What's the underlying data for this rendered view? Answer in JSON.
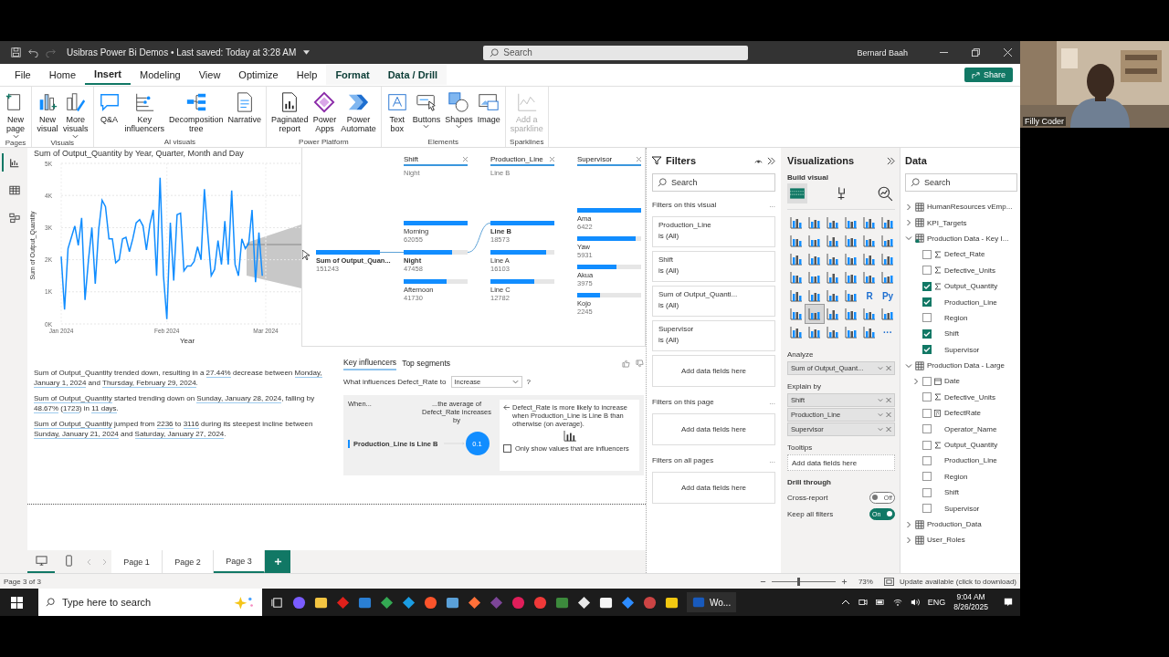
{
  "title_bar": {
    "title": "Usibras Power Bi Demos • Last saved: Today at 3:28 AM",
    "search": {
      "placeholder": "Search"
    },
    "user": "Bernard Baah"
  },
  "menu": [
    {
      "label": "File",
      "selected": false,
      "contextual": false
    },
    {
      "label": "Home",
      "selected": false,
      "contextual": false
    },
    {
      "label": "Insert",
      "selected": true,
      "contextual": false
    },
    {
      "label": "Modeling",
      "selected": false,
      "contextual": false
    },
    {
      "label": "View",
      "selected": false,
      "contextual": false
    },
    {
      "label": "Optimize",
      "selected": false,
      "contextual": false
    },
    {
      "label": "Help",
      "selected": false,
      "contextual": false
    },
    {
      "label": "Format",
      "selected": false,
      "contextual": true
    },
    {
      "label": "Data / Drill",
      "selected": false,
      "contextual": true
    }
  ],
  "share": "Share",
  "ribbon": [
    {
      "group": "Pages",
      "buttons": [
        {
          "lines": [
            "New",
            "page"
          ],
          "dropdown": true,
          "disabled": false
        }
      ]
    },
    {
      "group": "Visuals",
      "buttons": [
        {
          "lines": [
            "New",
            "visual"
          ],
          "dropdown": false,
          "disabled": false
        },
        {
          "lines": [
            "More",
            "visuals"
          ],
          "dropdown": true,
          "disabled": false
        }
      ]
    },
    {
      "group": "AI visuals",
      "buttons": [
        {
          "lines": [
            "Q&A"
          ],
          "dropdown": false,
          "disabled": false
        },
        {
          "lines": [
            "Key",
            "influencers"
          ],
          "dropdown": false,
          "disabled": false
        },
        {
          "lines": [
            "Decomposition",
            "tree"
          ],
          "dropdown": false,
          "disabled": false
        },
        {
          "lines": [
            "Narrative"
          ],
          "dropdown": false,
          "disabled": false
        }
      ]
    },
    {
      "group": "Power Platform",
      "buttons": [
        {
          "lines": [
            "Paginated",
            "report"
          ],
          "dropdown": false,
          "disabled": false
        },
        {
          "lines": [
            "Power",
            "Apps"
          ],
          "dropdown": false,
          "disabled": false
        },
        {
          "lines": [
            "Power",
            "Automate"
          ],
          "dropdown": false,
          "disabled": false
        }
      ]
    },
    {
      "group": "Elements",
      "buttons": [
        {
          "lines": [
            "Text",
            "box"
          ],
          "dropdown": false,
          "disabled": false
        },
        {
          "lines": [
            "Buttons"
          ],
          "dropdown": true,
          "disabled": false
        },
        {
          "lines": [
            "Shapes"
          ],
          "dropdown": true,
          "disabled": false
        },
        {
          "lines": [
            "Image"
          ],
          "dropdown": false,
          "disabled": false
        }
      ]
    },
    {
      "group": "Sparklines",
      "buttons": [
        {
          "lines": [
            "Add a",
            "sparkline"
          ],
          "dropdown": false,
          "disabled": true
        }
      ]
    }
  ],
  "view_rail": [
    {
      "selected": true
    },
    {
      "selected": false
    },
    {
      "selected": false
    }
  ],
  "line_chart": {
    "chart_data": {
      "type": "line",
      "title": "Sum of Output_Quantity by Year, Quarter, Month and Day",
      "xlabel": "Year",
      "ylabel": "Sum of Output_Quantity",
      "categories": [
        "Jan 2024",
        null,
        null,
        null,
        null,
        null,
        null,
        null,
        null,
        null,
        null,
        null,
        null,
        null,
        null,
        null,
        null,
        null,
        null,
        null,
        null,
        null,
        null,
        null,
        null,
        null,
        null,
        null,
        null,
        null,
        null,
        "Feb 2024",
        null,
        null,
        null,
        null,
        null,
        null,
        null,
        null,
        null,
        null,
        null,
        null,
        null,
        null,
        null,
        null,
        null,
        null,
        null,
        null,
        null,
        null,
        null,
        null,
        null,
        null,
        null,
        null,
        "Mar 2024"
      ],
      "ylim": [
        0,
        5000
      ],
      "grid": true,
      "yticks": [
        {
          "value": 0,
          "label": "0K"
        },
        {
          "value": 1000,
          "label": "1K"
        },
        {
          "value": 2000,
          "label": "2K"
        },
        {
          "value": 3000,
          "label": "3K"
        },
        {
          "value": 4000,
          "label": "4K"
        },
        {
          "value": 5000,
          "label": "5K"
        }
      ],
      "series": [
        {
          "color": "#118dff",
          "values": [
            2100,
            450,
            2350,
            2700,
            3050,
            2450,
            3300,
            750,
            2000,
            3000,
            1250,
            2950,
            3850,
            3650,
            2650,
            2650,
            1900,
            2000,
            2650,
            2700,
            2250,
            2650,
            3150,
            3250,
            3050,
            2300,
            3100,
            3550,
            1500,
            4550,
            1500,
            150,
            3150,
            1350,
            3400,
            3450,
            1650,
            1800,
            1800,
            1950,
            2400,
            2000,
            4200,
            2800,
            1500,
            1700,
            2600,
            1850,
            3200,
            1850,
            4150,
            1850,
            1500,
            2650,
            2350,
            2500,
            3550,
            1300,
            2850,
            1500,
            null
          ]
        }
      ]
    }
  },
  "decomposition_tree": {
    "root": {
      "name": "Sum of Output_Quan...",
      "value": "151243"
    },
    "levels": [
      {
        "header": "Shift",
        "filter": "Night",
        "nodes": [
          {
            "name": "Morning",
            "value": "62055",
            "level": 1,
            "selected": false
          },
          {
            "name": "Night",
            "value": "47458",
            "level": 0.76,
            "selected": true
          },
          {
            "name": "Afternoon",
            "value": "41730",
            "level": 0.67,
            "selected": false
          }
        ]
      },
      {
        "header": "Production_Line",
        "filter": "Line B",
        "nodes": [
          {
            "name": "Line B",
            "value": "18573",
            "level": 1,
            "selected": true
          },
          {
            "name": "Line A",
            "value": "16103",
            "level": 0.87,
            "selected": false
          },
          {
            "name": "Line C",
            "value": "12782",
            "level": 0.69,
            "selected": false
          }
        ]
      },
      {
        "header": "Supervisor",
        "nodes": [
          {
            "name": "Ama",
            "value": "6422",
            "level": 1,
            "selected": false
          },
          {
            "name": "Yaw",
            "value": "5931",
            "level": 0.92,
            "selected": false
          },
          {
            "name": "Akua",
            "value": "3975",
            "level": 0.62,
            "selected": false
          },
          {
            "name": "Kojo",
            "value": "2245",
            "level": 0.35,
            "selected": false
          }
        ]
      }
    ]
  },
  "narrative": [
    [
      {
        "text": "Sum of Output_Quantity trended down, resulting in a ",
        "underlined": false
      },
      {
        "text": "27.44%",
        "underlined": true
      },
      {
        "text": " decrease between ",
        "underlined": false
      },
      {
        "text": "Monday, January 1, 2024",
        "underlined": true
      },
      {
        "text": " and ",
        "underlined": false
      },
      {
        "text": "Thursday, February 29, 2024",
        "underlined": true
      },
      {
        "text": ".",
        "underlined": false
      }
    ],
    [
      {
        "text": "Sum of Output_Quantity",
        "underlined": true
      },
      {
        "text": " started trending down on ",
        "underlined": false
      },
      {
        "text": "Sunday, January 28, 2024",
        "underlined": true
      },
      {
        "text": ", falling by ",
        "underlined": false
      },
      {
        "text": "48.67%",
        "underlined": true
      },
      {
        "text": " (",
        "underlined": false
      },
      {
        "text": "1723",
        "underlined": true
      },
      {
        "text": ") in ",
        "underlined": false
      },
      {
        "text": "11 days",
        "underlined": true
      },
      {
        "text": ".",
        "underlined": false
      }
    ],
    [
      {
        "text": "Sum of Output_Quantity",
        "underlined": true
      },
      {
        "text": " jumped from ",
        "underlined": false
      },
      {
        "text": "2236",
        "underlined": true
      },
      {
        "text": " to ",
        "underlined": false
      },
      {
        "text": "3116",
        "underlined": true
      },
      {
        "text": " during its steepest incline between ",
        "underlined": false
      },
      {
        "text": "Sunday, January 21, 2024",
        "underlined": true
      },
      {
        "text": " and ",
        "underlined": false
      },
      {
        "text": "Saturday, January 27, 2024",
        "underlined": true
      },
      {
        "text": ".",
        "underlined": false
      }
    ]
  ],
  "key_influencers": {
    "tabs": [
      {
        "label": "Key influencers",
        "selected": true
      },
      {
        "label": "Top segments",
        "selected": false
      }
    ],
    "question": "What influences Defect_Rate to",
    "target": "Increase",
    "help": "?",
    "when": "When...",
    "effect": "...the average of Defect_Rate increases by",
    "factor": "Production_Line is Line B",
    "bubble": "0.1",
    "explanation": "Defect_Rate is more likely to increase when Production_Line is Line B than otherwise (on average).",
    "only_influencers": {
      "label": "Only show values that are influencers",
      "checked": false
    }
  },
  "page_tabs": [
    {
      "label": "Page 1",
      "selected": false
    },
    {
      "label": "Page 2",
      "selected": false
    },
    {
      "label": "Page 3",
      "selected": true
    }
  ],
  "layout_views": [
    {
      "selected": true
    },
    {
      "selected": false
    }
  ],
  "filters": {
    "title": "Filters",
    "search": {
      "placeholder": "Search"
    },
    "sections": [
      {
        "title": "Filters on this visual",
        "more": "...",
        "cards": [
          {
            "field": "Production_Line",
            "condition": "is (All)"
          },
          {
            "field": "Shift",
            "condition": "is (All)"
          },
          {
            "field": "Sum of Output_Quanti...",
            "condition": "is (All)"
          },
          {
            "field": "Supervisor",
            "condition": "is (All)"
          }
        ],
        "drop": "Add data fields here"
      },
      {
        "title": "Filters on this page",
        "more": "...",
        "drop": "Add data fields here"
      },
      {
        "title": "Filters on all pages",
        "more": "...",
        "drop": "Add data fields here"
      }
    ]
  },
  "visualizations": {
    "title": "Visualizations",
    "subtitle": "Build visual",
    "build_tabs": [
      {
        "selected": true
      },
      {
        "selected": false
      },
      {
        "selected": false
      }
    ],
    "types": [
      {
        "selected": false
      },
      {
        "selected": false
      },
      {
        "selected": false
      },
      {
        "selected": false
      },
      {
        "selected": false
      },
      {
        "selected": false
      },
      {
        "selected": false
      },
      {
        "selected": false
      },
      {
        "selected": false
      },
      {
        "selected": false
      },
      {
        "selected": false
      },
      {
        "selected": false
      },
      {
        "selected": false
      },
      {
        "selected": false
      },
      {
        "selected": false
      },
      {
        "selected": false
      },
      {
        "selected": false
      },
      {
        "selected": false
      },
      {
        "selected": false
      },
      {
        "selected": false
      },
      {
        "selected": false
      },
      {
        "selected": false
      },
      {
        "selected": false
      },
      {
        "selected": false
      },
      {
        "selected": false
      },
      {
        "selected": false
      },
      {
        "selected": false
      },
      {
        "selected": false
      },
      {
        "label": "R",
        "selected": false
      },
      {
        "label": "Py",
        "selected": false
      },
      {
        "selected": false
      },
      {
        "selected": true
      },
      {
        "selected": false
      },
      {
        "selected": false
      },
      {
        "selected": false
      },
      {
        "selected": false
      },
      {
        "selected": false
      },
      {
        "selected": false
      },
      {
        "selected": false
      },
      {
        "selected": false
      },
      {
        "selected": false
      },
      {
        "label": "···",
        "selected": false
      }
    ],
    "wells": [
      {
        "title": "Analyze",
        "fields": [
          "Sum of Output_Quant..."
        ]
      },
      {
        "title": "Explain by",
        "fields": [
          "Shift",
          "Production_Line",
          "Supervisor"
        ]
      },
      {
        "title": "Tooltips",
        "drop": "Add data fields here"
      }
    ],
    "drill_title": "Drill through",
    "toggles": [
      {
        "label": "Cross-report",
        "on": false,
        "text": "Off"
      },
      {
        "label": "Keep all filters",
        "on": true,
        "text": "On"
      }
    ]
  },
  "data_pane": {
    "title": "Data",
    "search": {
      "placeholder": "Search"
    },
    "tables": [
      {
        "name": "HumanResources vEmp...",
        "expanded": false,
        "in_use": false
      },
      {
        "name": "KPI_Targets",
        "expanded": false,
        "in_use": false
      },
      {
        "name": "Production Data - Key I...",
        "expanded": true,
        "in_use": true,
        "children": [
          {
            "name": "Defect_Rate",
            "kind": "sum",
            "checked": false
          },
          {
            "name": "Defective_Units",
            "kind": "sum",
            "checked": false
          },
          {
            "name": "Output_Quantity",
            "kind": "sum",
            "checked": true
          },
          {
            "name": "Production_Line",
            "kind": "plain",
            "checked": true
          },
          {
            "name": "Region",
            "kind": "plain",
            "checked": false
          },
          {
            "name": "Shift",
            "kind": "plain",
            "checked": true
          },
          {
            "name": "Supervisor",
            "kind": "plain",
            "checked": true
          }
        ]
      },
      {
        "name": "Production Data - Large",
        "expanded": true,
        "in_use": false,
        "children": [
          {
            "name": "Date",
            "kind": "date",
            "checked": false,
            "expanded": false
          },
          {
            "name": "Defective_Units",
            "kind": "sum",
            "checked": false
          },
          {
            "name": "DefectRate",
            "kind": "measure",
            "checked": false
          },
          {
            "name": "Operator_Name",
            "kind": "plain",
            "checked": false
          },
          {
            "name": "Output_Quantity",
            "kind": "sum",
            "checked": false
          },
          {
            "name": "Production_Line",
            "kind": "plain",
            "checked": false
          },
          {
            "name": "Region",
            "kind": "plain",
            "checked": false
          },
          {
            "name": "Shift",
            "kind": "plain",
            "checked": false
          },
          {
            "name": "Supervisor",
            "kind": "plain",
            "checked": false
          }
        ]
      },
      {
        "name": "Production_Data",
        "expanded": false,
        "in_use": false
      },
      {
        "name": "User_Roles",
        "expanded": false,
        "in_use": false
      }
    ]
  },
  "status_bar": {
    "page": "Page 3 of 3",
    "zoom": {
      "level": 0.4,
      "reading": "73%"
    },
    "update": "Update available (click to download)"
  },
  "webcam": {
    "kind": "picture",
    "caption": "Filly Coder"
  },
  "taskbar": {
    "search": {
      "placeholder": "Type here to search"
    },
    "apps": [
      {
        "color": "#7a5cff"
      },
      {
        "color": "#f4c542"
      },
      {
        "color": "#e0201b"
      },
      {
        "color": "#2a7fd4"
      },
      {
        "color": "#34a853"
      },
      {
        "color": "#1b9de2"
      },
      {
        "color": "#fb542b"
      },
      {
        "color": "#5aa0d8"
      },
      {
        "color": "#ff7139"
      },
      {
        "color": "#7d4698"
      },
      {
        "color": "#e01e5a"
      },
      {
        "color": "#ef3939"
      },
      {
        "color": "#3c8a3c"
      },
      {
        "color": "#e8e8e8"
      },
      {
        "color": "#f5f5f5"
      },
      {
        "color": "#2d8cff"
      },
      {
        "color": "#cc4444"
      },
      {
        "color": "#f2c811"
      }
    ],
    "word_app": "Wo...",
    "language": "ENG",
    "time": "9:04 AM",
    "date": "8/26/2025"
  }
}
